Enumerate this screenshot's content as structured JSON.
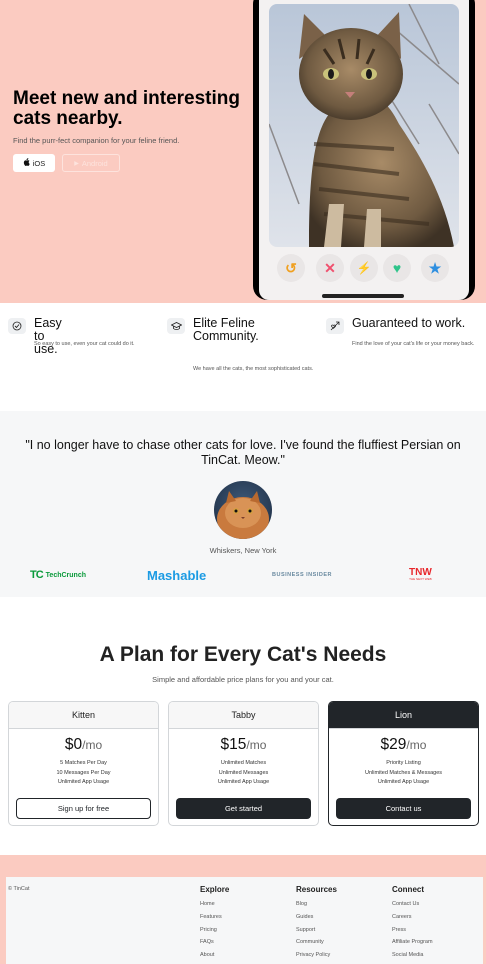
{
  "hero": {
    "title": "Meet new and interesting cats nearby.",
    "subtitle": "Find the purr-fect companion for your feline friend.",
    "ios_label": "iOS",
    "android_label": "Android"
  },
  "features": [
    {
      "icon": "checkmark-icon",
      "title": "Easy to use.",
      "desc": "So easy to use, even your cat could do it."
    },
    {
      "icon": "graduation-cap-icon",
      "title": "Elite Feline Community.",
      "desc": "We have all the cats, the most sophisticated cats."
    },
    {
      "icon": "heart-arrow-icon",
      "title": "Guaranteed to work.",
      "desc": "Find the love of your cat's life or your money back."
    }
  ],
  "testimonial": {
    "quote": "\"I no longer have to chase other cats for love. I've found the fluffiest Persian on TinCat. Meow.\"",
    "author": "Whiskers, New York"
  },
  "press": {
    "techcrunch": "TechCrunch",
    "mashable": "Mashable",
    "business_insider": "BUSINESS INSIDER",
    "tnw": "TNW",
    "tnw_sub": "THE NEXT WEB"
  },
  "pricing": {
    "title": "A Plan for Every Cat's Needs",
    "subtitle": "Simple and affordable price plans for you and your cat.",
    "plans": [
      {
        "name": "Kitten",
        "price": "$0",
        "period": "/mo",
        "features": [
          "5 Matches Per Day",
          "10 Messages Per Day",
          "Unlimited App Usage"
        ],
        "cta": "Sign up for free"
      },
      {
        "name": "Tabby",
        "price": "$15",
        "period": "/mo",
        "features": [
          "Unlimited Matches",
          "Unlimited Messages",
          "Unlimited App Usage"
        ],
        "cta": "Get started"
      },
      {
        "name": "Lion",
        "price": "$29",
        "period": "/mo",
        "features": [
          "Priority Listing",
          "Unlimited Matches & Messages",
          "Unlimited App Usage"
        ],
        "cta": "Contact us"
      }
    ]
  },
  "footer": {
    "copyright": "© TinCat",
    "columns": [
      {
        "title": "Explore",
        "links": [
          "Home",
          "Features",
          "Pricing",
          "FAQs",
          "About"
        ]
      },
      {
        "title": "Resources",
        "links": [
          "Blog",
          "Guides",
          "Support",
          "Community",
          "Privacy Policy"
        ]
      },
      {
        "title": "Connect",
        "links": [
          "Contact Us",
          "Careers",
          "Press",
          "Affiliate Program",
          "Social Media"
        ]
      }
    ]
  },
  "colors": {
    "hero_bg": "#fbcbc1",
    "dark": "#212529",
    "tc_green": "#0a9a3b",
    "mashable_blue": "#1c9be3",
    "tnw_red": "#e8272c"
  }
}
